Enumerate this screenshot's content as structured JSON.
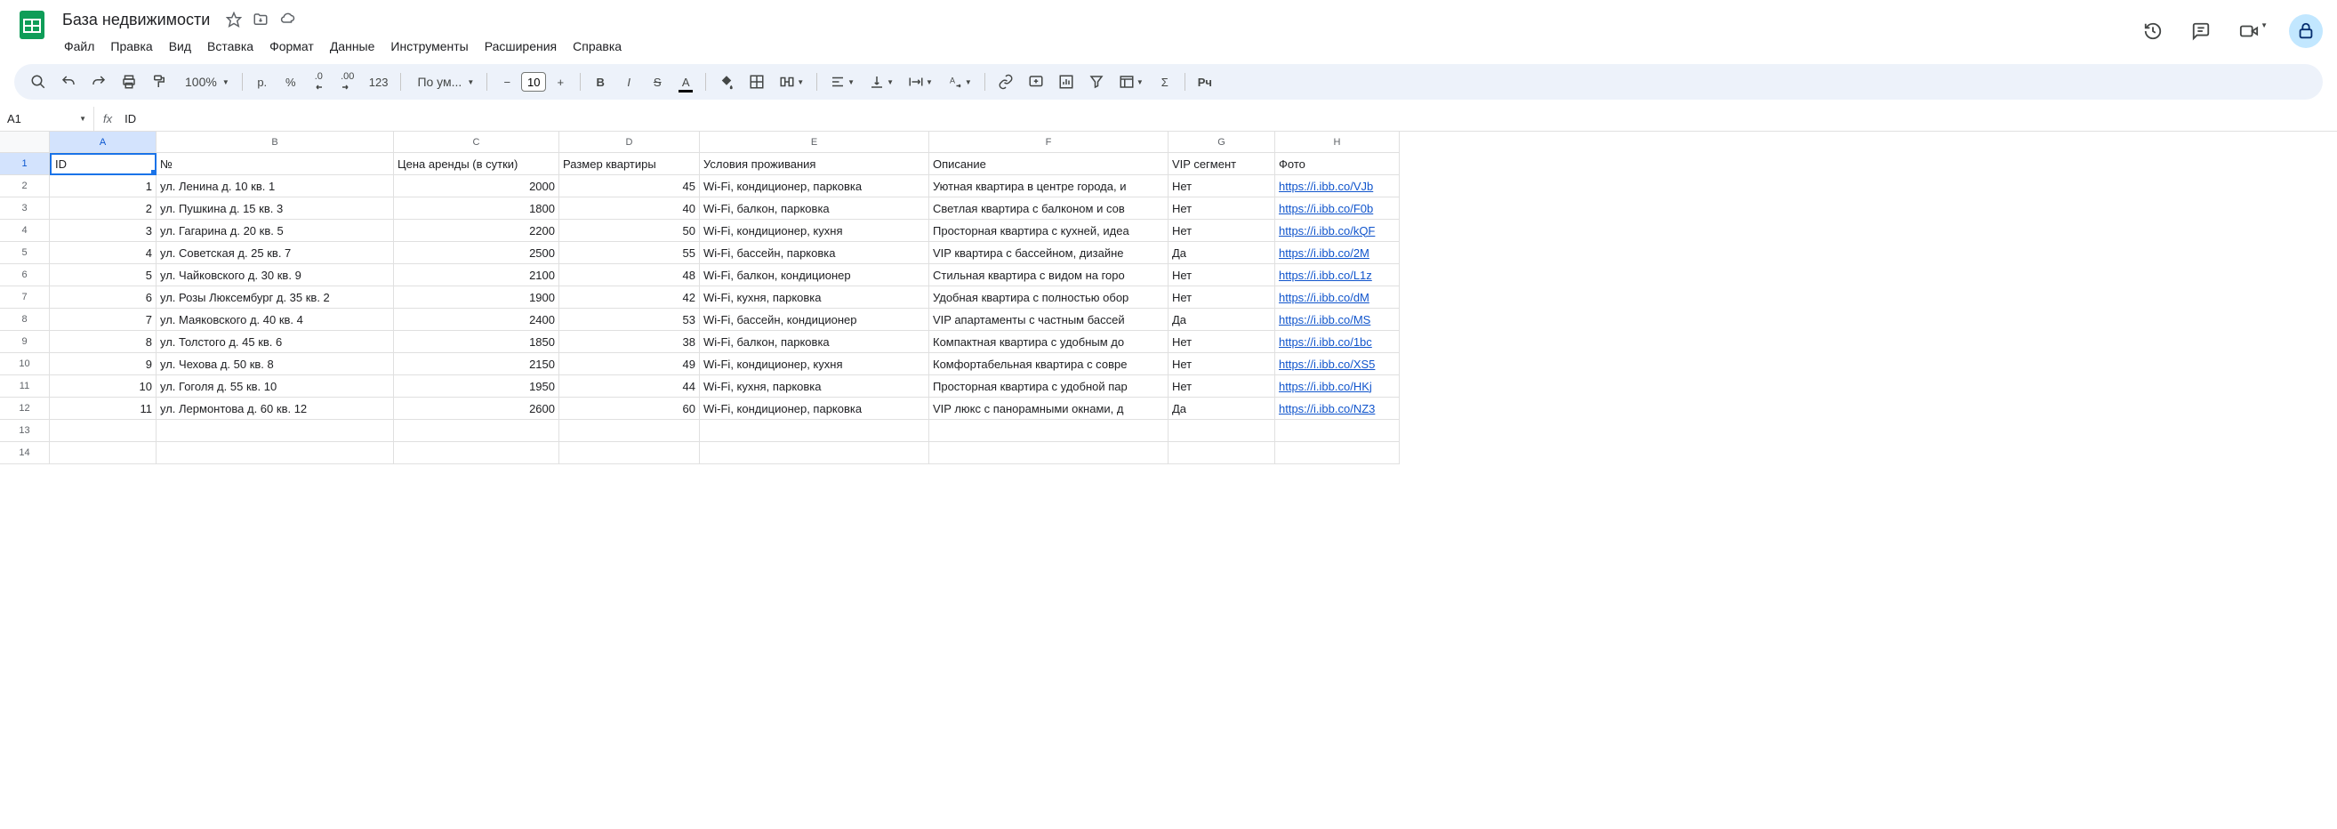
{
  "doc_title": "База недвижимости",
  "menu": [
    "Файл",
    "Правка",
    "Вид",
    "Вставка",
    "Формат",
    "Данные",
    "Инструменты",
    "Расширения",
    "Справка"
  ],
  "toolbar": {
    "zoom": "100%",
    "currency": "р.",
    "percent": "%",
    "dec_dec": ".0",
    "inc_dec": ".00",
    "num_fmt": "123",
    "font": "По ум...",
    "font_size": "10"
  },
  "name_box": "A1",
  "formula_bar": "ID",
  "columns": [
    "A",
    "B",
    "C",
    "D",
    "E",
    "F",
    "G",
    "H"
  ],
  "headers": [
    "ID",
    "№",
    "Цена аренды (в сутки)",
    "Размер квартиры",
    "Условия проживания",
    "Описание",
    "VIP сегмент",
    "Фото"
  ],
  "rows": [
    {
      "id": "1",
      "addr": "ул. Ленина д. 10 кв. 1",
      "price": "2000",
      "size": "45",
      "cond": "Wi-Fi, кондиционер, парковка",
      "desc": "Уютная квартира в центре города, и",
      "vip": "Нет",
      "photo": "https://i.ibb.co/VJb"
    },
    {
      "id": "2",
      "addr": "ул. Пушкина д. 15 кв. 3",
      "price": "1800",
      "size": "40",
      "cond": "Wi-Fi, балкон, парковка",
      "desc": "Светлая квартира с балконом и сов",
      "vip": "Нет",
      "photo": "https://i.ibb.co/F0b"
    },
    {
      "id": "3",
      "addr": "ул. Гагарина д. 20 кв. 5",
      "price": "2200",
      "size": "50",
      "cond": "Wi-Fi, кондиционер, кухня",
      "desc": "Просторная квартира с кухней, идеа",
      "vip": "Нет",
      "photo": "https://i.ibb.co/kQF"
    },
    {
      "id": "4",
      "addr": "ул. Советская д. 25 кв. 7",
      "price": "2500",
      "size": "55",
      "cond": "Wi-Fi, бассейн, парковка",
      "desc": "VIP квартира с бассейном, дизайне",
      "vip": "Да",
      "photo": "https://i.ibb.co/2M"
    },
    {
      "id": "5",
      "addr": "ул. Чайковского д. 30 кв. 9",
      "price": "2100",
      "size": "48",
      "cond": "Wi-Fi, балкон, кондиционер",
      "desc": "Стильная квартира с видом на горо",
      "vip": "Нет",
      "photo": "https://i.ibb.co/L1z"
    },
    {
      "id": "6",
      "addr": "ул. Розы Люксембург д. 35 кв. 2",
      "price": "1900",
      "size": "42",
      "cond": "Wi-Fi, кухня, парковка",
      "desc": "Удобная квартира с полностью обор",
      "vip": "Нет",
      "photo": "https://i.ibb.co/dM"
    },
    {
      "id": "7",
      "addr": "ул. Маяковского д. 40 кв. 4",
      "price": "2400",
      "size": "53",
      "cond": "Wi-Fi, бассейн, кондиционер",
      "desc": "VIP апартаменты с частным бассей",
      "vip": "Да",
      "photo": "https://i.ibb.co/MS"
    },
    {
      "id": "8",
      "addr": "ул. Толстого д. 45 кв. 6",
      "price": "1850",
      "size": "38",
      "cond": "Wi-Fi, балкон, парковка",
      "desc": "Компактная квартира с удобным до",
      "vip": "Нет",
      "photo": "https://i.ibb.co/1bc"
    },
    {
      "id": "9",
      "addr": "ул. Чехова д. 50 кв. 8",
      "price": "2150",
      "size": "49",
      "cond": "Wi-Fi, кондиционер, кухня",
      "desc": "Комфортабельная квартира с совре",
      "vip": "Нет",
      "photo": "https://i.ibb.co/XS5"
    },
    {
      "id": "10",
      "addr": "ул. Гоголя д. 55 кв. 10",
      "price": "1950",
      "size": "44",
      "cond": "Wi-Fi, кухня, парковка",
      "desc": "Просторная квартира с удобной пар",
      "vip": "Нет",
      "photo": "https://i.ibb.co/HKj"
    },
    {
      "id": "11",
      "addr": "ул. Лермонтова д. 60 кв. 12",
      "price": "2600",
      "size": "60",
      "cond": "Wi-Fi, кондиционер, парковка",
      "desc": "VIP люкс с панорамными окнами, д",
      "vip": "Да",
      "photo": "https://i.ibb.co/NZ3"
    }
  ]
}
